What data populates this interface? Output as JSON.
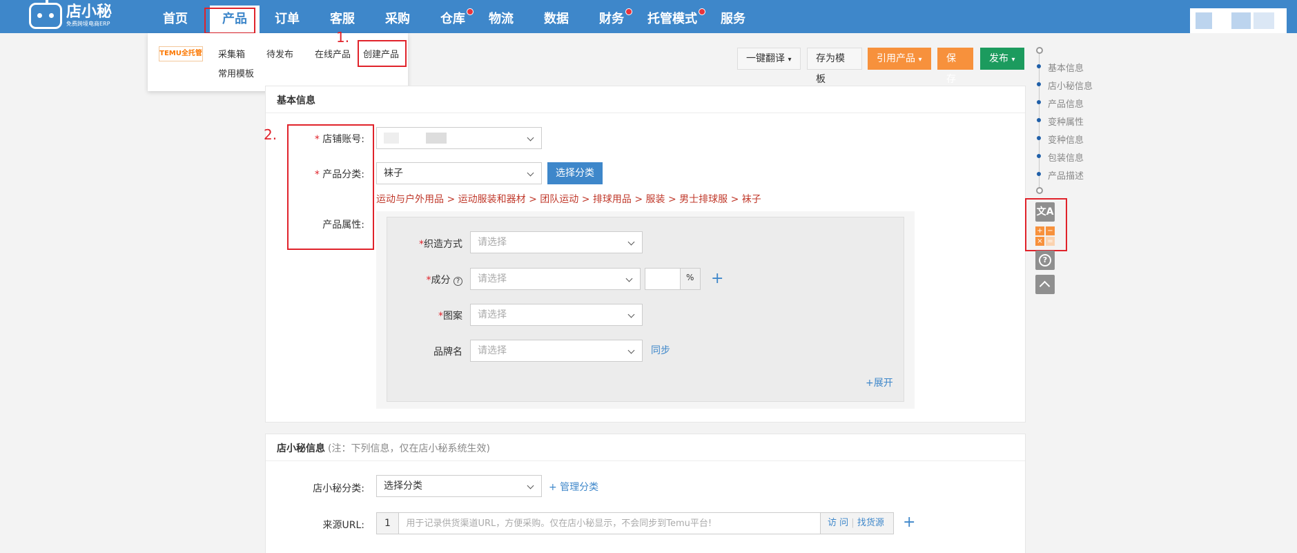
{
  "brand": {
    "name": "店小秘",
    "sub": "免费跨境电商ERP"
  },
  "nav": {
    "items": [
      {
        "label": "首页",
        "dot": false
      },
      {
        "label": "产品",
        "dot": false,
        "active": true
      },
      {
        "label": "订单",
        "dot": false
      },
      {
        "label": "客服",
        "dot": false
      },
      {
        "label": "采购",
        "dot": false
      },
      {
        "label": "仓库",
        "dot": true
      },
      {
        "label": "物流",
        "dot": false
      },
      {
        "label": "数据",
        "dot": false
      },
      {
        "label": "财务",
        "dot": true
      },
      {
        "label": "托管模式",
        "dot": true
      },
      {
        "label": "服务",
        "dot": false
      }
    ]
  },
  "dropdown": {
    "temu_logo": "TEMU全托管",
    "items": [
      "采集箱",
      "待发布",
      "在线产品",
      "创建产品"
    ],
    "second_row": "常用模板"
  },
  "annotations": {
    "step1": "1.",
    "step2": "2."
  },
  "toolbar": {
    "translate": "一键翻译",
    "save_template": "存为模板",
    "quote_product": "引用产品",
    "save": "保存",
    "publish": "发布"
  },
  "basic": {
    "title": "基本信息",
    "shop_label": "店铺账号:",
    "category_label": "产品分类:",
    "category_value": "袜子",
    "choose_category": "选择分类",
    "breadcrumb": "运动与户外用品  > 运动服装和器材  > 团队运动  > 排球用品  > 服装  > 男士排球服  > 袜子",
    "attr_label": "产品属性:",
    "attrs": {
      "weave": {
        "label": "织造方式",
        "placeholder": "请选择"
      },
      "composition": {
        "label": "成分",
        "placeholder": "请选择",
        "unit": "%"
      },
      "pattern": {
        "label": "图案",
        "placeholder": "请选择"
      },
      "brand": {
        "label": "品牌名",
        "placeholder": "请选择",
        "sync": "同步"
      }
    },
    "expand": "+展开"
  },
  "dxm": {
    "title": "店小秘信息",
    "note": "(注：下列信息，仅在店小秘系统生效)",
    "category_label": "店小秘分类:",
    "category_value": "选择分类",
    "manage": "+ 管理分类",
    "source_label": "来源URL:",
    "source_index": "1",
    "source_placeholder": "用于记录供货渠道URL，方便采购。仅在店小秘显示，不会同步到Temu平台!",
    "visit": "访 问",
    "find_source": "找货源"
  },
  "side_nav": [
    "基本信息",
    "店小秘信息",
    "产品信息",
    "变种属性",
    "变种信息",
    "包装信息",
    "产品描述"
  ],
  "tools": {
    "translate_icon": "文A",
    "calc_icon": "+−×="
  }
}
